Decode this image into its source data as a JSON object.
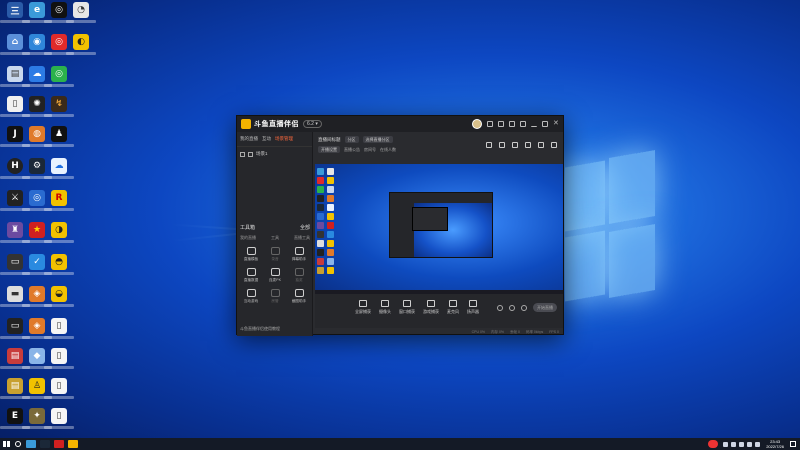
{
  "app": {
    "name": "斗鱼直播伴侣",
    "version_badge": "6.2 ▾",
    "left_tabs": [
      "我的直播",
      "互动",
      "场景管理"
    ],
    "scene_label": "场景1",
    "tools_title": "工具箱",
    "tools_more": "全部",
    "tool_tabs": [
      "我的直播",
      "工具",
      "直播工具"
    ],
    "tools": [
      {
        "label": "直播模板",
        "dim": false
      },
      {
        "label": "录音",
        "dim": true
      },
      {
        "label": "弹幕助手",
        "dim": false
      },
      {
        "label": "直播数据",
        "dim": false
      },
      {
        "label": "连麦PK",
        "dim": false
      },
      {
        "label": "抽奖",
        "dim": true
      },
      {
        "label": "互动游戏",
        "dim": false
      },
      {
        "label": "房管",
        "dim": true
      },
      {
        "label": "截图助手",
        "dim": false
      }
    ],
    "left_footer": "斗鱼直播伴侣使用教程",
    "room_title": "直播间标题",
    "room_category": "分区",
    "room_edit": "选择直播分区",
    "room_sub": [
      "开播设置",
      "直播公告",
      "房间号",
      "在线人数"
    ],
    "bottom_items": [
      "全屏捕获",
      "摄像头",
      "窗口捕获",
      "游戏捕获",
      "麦克风",
      "扬声器"
    ],
    "start_live": "开始直播",
    "status_bar": [
      "CPU 0%",
      "内存 0%",
      "丢帧 0",
      "码率 0kbps",
      "FPS 0"
    ]
  },
  "taskbar": {
    "time": "23:43",
    "date": "2022/7/26"
  }
}
